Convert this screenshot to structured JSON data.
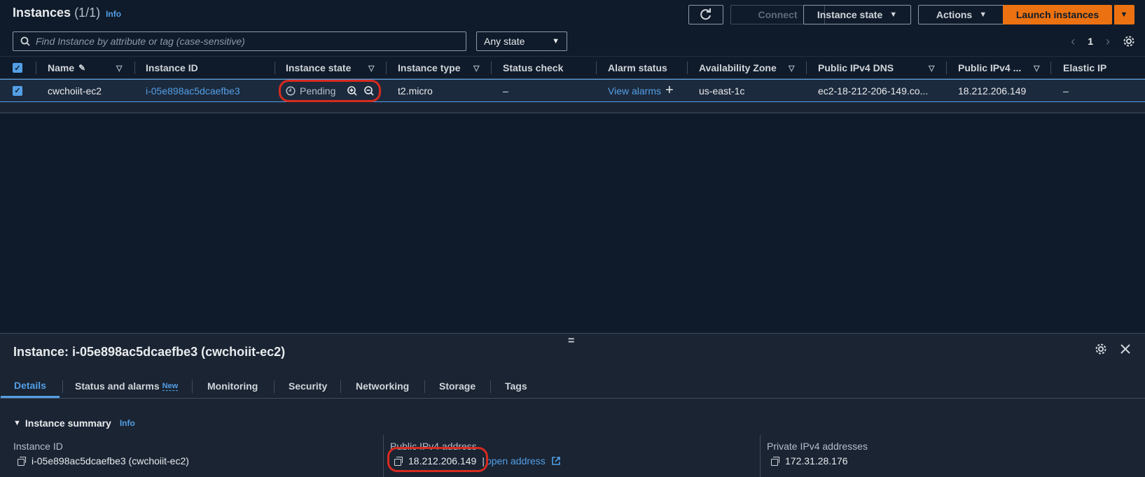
{
  "header": {
    "title": "Instances",
    "count": "(1/1)",
    "info": "Info",
    "buttons": {
      "refresh_icon": "refresh-icon",
      "connect": "Connect",
      "instance_state": "Instance state",
      "actions": "Actions",
      "launch": "Launch instances"
    }
  },
  "search": {
    "placeholder": "Find Instance by attribute or tag (case-sensitive)"
  },
  "filter": {
    "selected": "Any state"
  },
  "pagination": {
    "page": "1"
  },
  "table": {
    "columns": [
      "Name",
      "Instance ID",
      "Instance state",
      "Instance type",
      "Status check",
      "Alarm status",
      "Availability Zone",
      "Public IPv4 DNS",
      "Public IPv4 ...",
      "Elastic IP"
    ],
    "row": {
      "name": "cwchoiit-ec2",
      "instance_id": "i-05e898ac5dcaefbe3",
      "state": "Pending",
      "type": "t2.micro",
      "status_check": "–",
      "alarm": "View alarms",
      "zone": "us-east-1c",
      "dns": "ec2-18-212-206-149.co...",
      "ipv4": "18.212.206.149",
      "elastic_ip": "–"
    }
  },
  "details": {
    "title": "Instance: i-05e898ac5dcaefbe3 (cwchoiit-ec2)",
    "tabs": [
      "Details",
      "Status and alarms",
      "Monitoring",
      "Security",
      "Networking",
      "Storage",
      "Tags"
    ],
    "new_badge": "New",
    "summary_title": "Instance summary",
    "summary_info": "Info",
    "fields": {
      "instance_id_label": "Instance ID",
      "instance_id_value": "i-05e898ac5dcaefbe3 (cwchoiit-ec2)",
      "public_ipv4_label": "Public IPv4 address",
      "public_ipv4_value": "18.212.206.149",
      "open_address": "open address",
      "private_ipv4_label": "Private IPv4 addresses",
      "private_ipv4_value": "172.31.28.176"
    }
  },
  "colors": {
    "accent": "#539fe5",
    "primary": "#ec7211",
    "annotation": "#d62b1f"
  }
}
